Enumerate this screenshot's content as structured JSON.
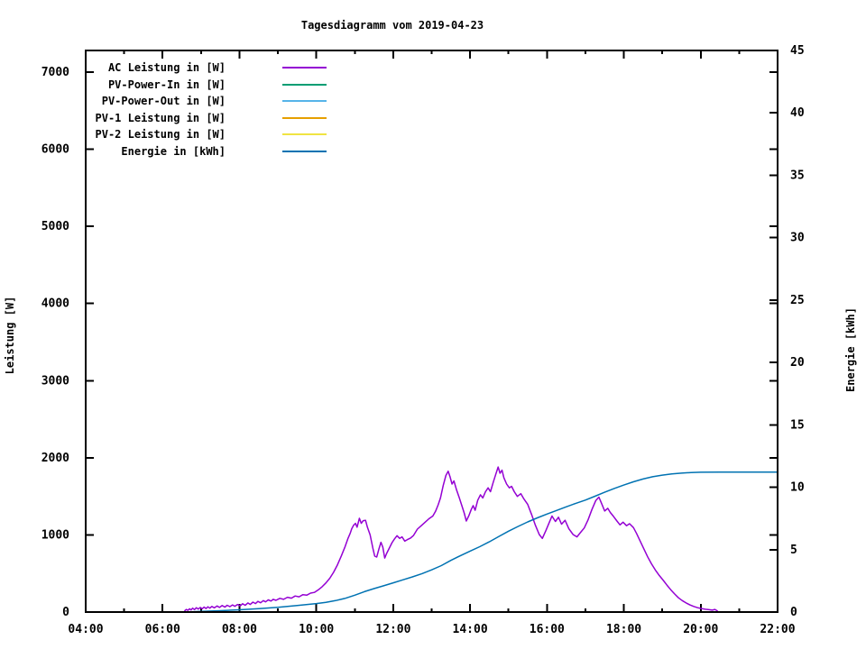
{
  "title": "Tagesdiagramm vom 2019-04-23",
  "colors": {
    "background": "#ffffff",
    "axis": "#000000",
    "ac_leistung": "#9400d3",
    "pv_power_in": "#009e73",
    "pv_power_out": "#56b4e9",
    "pv1_leistung": "#e69f00",
    "pv2_leistung": "#f0e442",
    "energie": "#0072b2"
  },
  "legend": {
    "items": [
      {
        "label": "AC Leistung in [W]",
        "color": "#9400d3"
      },
      {
        "label": "PV-Power-In in [W]",
        "color": "#009e73"
      },
      {
        "label": "PV-Power-Out in [W]",
        "color": "#56b4e9"
      },
      {
        "label": "PV-1 Leistung in [W]",
        "color": "#e69f00"
      },
      {
        "label": "PV-2 Leistung in [W]",
        "color": "#f0e442"
      },
      {
        "label": "Energie in [kWh]",
        "color": "#0072b2"
      }
    ]
  },
  "axes": {
    "x": {
      "range_hours": [
        4,
        22
      ],
      "major_ticks": [
        {
          "hour": 4,
          "label": "04:00"
        },
        {
          "hour": 6,
          "label": "06:00"
        },
        {
          "hour": 8,
          "label": "08:00"
        },
        {
          "hour": 10,
          "label": "10:00"
        },
        {
          "hour": 12,
          "label": "12:00"
        },
        {
          "hour": 14,
          "label": "14:00"
        },
        {
          "hour": 16,
          "label": "16:00"
        },
        {
          "hour": 18,
          "label": "18:00"
        },
        {
          "hour": 20,
          "label": "20:00"
        },
        {
          "hour": 22,
          "label": "22:00"
        }
      ],
      "minor_tick_hours": [
        5,
        7,
        9,
        11,
        13,
        15,
        17,
        19,
        21
      ]
    },
    "y_left": {
      "label": "Leistung [W]",
      "range": [
        0,
        7281
      ],
      "ticks": [
        {
          "value": 0,
          "label": "0"
        },
        {
          "value": 1000,
          "label": "1000"
        },
        {
          "value": 2000,
          "label": "2000"
        },
        {
          "value": 3000,
          "label": "3000"
        },
        {
          "value": 4000,
          "label": "4000"
        },
        {
          "value": 5000,
          "label": "5000"
        },
        {
          "value": 6000,
          "label": "6000"
        },
        {
          "value": 7000,
          "label": "7000"
        }
      ]
    },
    "y_right": {
      "label": "Energie [kWh]",
      "range": [
        0,
        45
      ],
      "ticks": [
        {
          "value": 0,
          "label": "0"
        },
        {
          "value": 5,
          "label": "5"
        },
        {
          "value": 10,
          "label": "10"
        },
        {
          "value": 15,
          "label": "15"
        },
        {
          "value": 20,
          "label": "20"
        },
        {
          "value": 25,
          "label": "25"
        },
        {
          "value": 30,
          "label": "30"
        },
        {
          "value": 35,
          "label": "35"
        },
        {
          "value": 40,
          "label": "40"
        },
        {
          "value": 45,
          "label": "45"
        }
      ]
    }
  },
  "chart_data": {
    "type": "line",
    "title": "Tagesdiagramm vom 2019-04-23",
    "x_unit": "hour_of_day",
    "xlim": [
      4,
      22
    ],
    "ylim_left": [
      0,
      7281
    ],
    "ylim_right": [
      0,
      45
    ],
    "grid": false,
    "legend_position": "top-left-inside",
    "series": [
      {
        "name": "AC Leistung in [W]",
        "color": "#9400d3",
        "axis": "left",
        "points": [
          [
            6.58,
            18
          ],
          [
            6.62,
            34
          ],
          [
            6.66,
            22
          ],
          [
            6.7,
            42
          ],
          [
            6.74,
            27
          ],
          [
            6.78,
            50
          ],
          [
            6.83,
            32
          ],
          [
            6.88,
            56
          ],
          [
            6.93,
            38
          ],
          [
            6.98,
            60
          ],
          [
            7.03,
            42
          ],
          [
            7.08,
            64
          ],
          [
            7.13,
            46
          ],
          [
            7.18,
            68
          ],
          [
            7.23,
            50
          ],
          [
            7.28,
            72
          ],
          [
            7.35,
            55
          ],
          [
            7.42,
            78
          ],
          [
            7.48,
            60
          ],
          [
            7.55,
            84
          ],
          [
            7.62,
            64
          ],
          [
            7.68,
            88
          ],
          [
            7.75,
            70
          ],
          [
            7.82,
            92
          ],
          [
            7.88,
            75
          ],
          [
            7.95,
            98
          ],
          [
            8.02,
            80
          ],
          [
            8.08,
            108
          ],
          [
            8.15,
            88
          ],
          [
            8.22,
            118
          ],
          [
            8.28,
            98
          ],
          [
            8.35,
            128
          ],
          [
            8.42,
            110
          ],
          [
            8.48,
            138
          ],
          [
            8.55,
            120
          ],
          [
            8.62,
            148
          ],
          [
            8.68,
            132
          ],
          [
            8.75,
            158
          ],
          [
            8.82,
            142
          ],
          [
            8.88,
            165
          ],
          [
            8.95,
            152
          ],
          [
            9.05,
            178
          ],
          [
            9.15,
            165
          ],
          [
            9.25,
            192
          ],
          [
            9.35,
            180
          ],
          [
            9.45,
            208
          ],
          [
            9.55,
            198
          ],
          [
            9.65,
            225
          ],
          [
            9.75,
            218
          ],
          [
            9.85,
            245
          ],
          [
            9.95,
            255
          ],
          [
            10.05,
            288
          ],
          [
            10.15,
            328
          ],
          [
            10.25,
            378
          ],
          [
            10.35,
            438
          ],
          [
            10.45,
            515
          ],
          [
            10.55,
            612
          ],
          [
            10.65,
            728
          ],
          [
            10.75,
            850
          ],
          [
            10.82,
            950
          ],
          [
            10.88,
            1020
          ],
          [
            10.92,
            1080
          ],
          [
            10.97,
            1125
          ],
          [
            11.02,
            1150
          ],
          [
            11.06,
            1100
          ],
          [
            11.12,
            1215
          ],
          [
            11.17,
            1150
          ],
          [
            11.22,
            1185
          ],
          [
            11.28,
            1190
          ],
          [
            11.33,
            1100
          ],
          [
            11.4,
            1000
          ],
          [
            11.47,
            830
          ],
          [
            11.52,
            725
          ],
          [
            11.57,
            713
          ],
          [
            11.63,
            820
          ],
          [
            11.68,
            905
          ],
          [
            11.73,
            840
          ],
          [
            11.78,
            700
          ],
          [
            11.83,
            760
          ],
          [
            11.9,
            830
          ],
          [
            11.97,
            900
          ],
          [
            12.03,
            945
          ],
          [
            12.1,
            990
          ],
          [
            12.17,
            955
          ],
          [
            12.23,
            975
          ],
          [
            12.3,
            920
          ],
          [
            12.37,
            940
          ],
          [
            12.45,
            960
          ],
          [
            12.53,
            995
          ],
          [
            12.63,
            1075
          ],
          [
            12.73,
            1120
          ],
          [
            12.83,
            1165
          ],
          [
            12.93,
            1210
          ],
          [
            13.03,
            1245
          ],
          [
            13.1,
            1305
          ],
          [
            13.17,
            1390
          ],
          [
            13.23,
            1480
          ],
          [
            13.3,
            1640
          ],
          [
            13.37,
            1770
          ],
          [
            13.43,
            1825
          ],
          [
            13.48,
            1750
          ],
          [
            13.53,
            1660
          ],
          [
            13.58,
            1700
          ],
          [
            13.65,
            1580
          ],
          [
            13.72,
            1480
          ],
          [
            13.78,
            1390
          ],
          [
            13.85,
            1280
          ],
          [
            13.9,
            1180
          ],
          [
            13.97,
            1250
          ],
          [
            14.03,
            1330
          ],
          [
            14.08,
            1380
          ],
          [
            14.13,
            1320
          ],
          [
            14.2,
            1450
          ],
          [
            14.27,
            1520
          ],
          [
            14.33,
            1480
          ],
          [
            14.4,
            1560
          ],
          [
            14.47,
            1610
          ],
          [
            14.53,
            1560
          ],
          [
            14.6,
            1680
          ],
          [
            14.67,
            1790
          ],
          [
            14.73,
            1880
          ],
          [
            14.78,
            1800
          ],
          [
            14.83,
            1840
          ],
          [
            14.88,
            1740
          ],
          [
            14.95,
            1660
          ],
          [
            15.02,
            1610
          ],
          [
            15.08,
            1630
          ],
          [
            15.15,
            1560
          ],
          [
            15.23,
            1500
          ],
          [
            15.32,
            1535
          ],
          [
            15.4,
            1465
          ],
          [
            15.5,
            1395
          ],
          [
            15.6,
            1265
          ],
          [
            15.7,
            1125
          ],
          [
            15.8,
            1005
          ],
          [
            15.88,
            955
          ],
          [
            15.97,
            1055
          ],
          [
            16.05,
            1150
          ],
          [
            16.13,
            1245
          ],
          [
            16.22,
            1175
          ],
          [
            16.3,
            1230
          ],
          [
            16.38,
            1140
          ],
          [
            16.47,
            1190
          ],
          [
            16.57,
            1080
          ],
          [
            16.68,
            1005
          ],
          [
            16.78,
            975
          ],
          [
            16.88,
            1035
          ],
          [
            16.97,
            1090
          ],
          [
            17.07,
            1195
          ],
          [
            17.17,
            1330
          ],
          [
            17.27,
            1445
          ],
          [
            17.35,
            1490
          ],
          [
            17.43,
            1395
          ],
          [
            17.5,
            1310
          ],
          [
            17.58,
            1345
          ],
          [
            17.65,
            1290
          ],
          [
            17.73,
            1240
          ],
          [
            17.82,
            1180
          ],
          [
            17.9,
            1130
          ],
          [
            17.98,
            1165
          ],
          [
            18.07,
            1120
          ],
          [
            18.15,
            1145
          ],
          [
            18.25,
            1095
          ],
          [
            18.33,
            1020
          ],
          [
            18.42,
            925
          ],
          [
            18.52,
            820
          ],
          [
            18.62,
            715
          ],
          [
            18.72,
            625
          ],
          [
            18.82,
            545
          ],
          [
            18.92,
            475
          ],
          [
            19.02,
            415
          ],
          [
            19.12,
            350
          ],
          [
            19.22,
            290
          ],
          [
            19.32,
            235
          ],
          [
            19.42,
            185
          ],
          [
            19.52,
            148
          ],
          [
            19.62,
            118
          ],
          [
            19.72,
            92
          ],
          [
            19.82,
            72
          ],
          [
            19.92,
            56
          ],
          [
            20.02,
            45
          ],
          [
            20.12,
            36
          ],
          [
            20.22,
            30
          ],
          [
            20.3,
            24
          ],
          [
            20.37,
            34
          ],
          [
            20.43,
            16
          ]
        ]
      },
      {
        "name": "PV-Power-In in [W]",
        "color": "#009e73",
        "axis": "left",
        "points": []
      },
      {
        "name": "PV-Power-Out in [W]",
        "color": "#56b4e9",
        "axis": "left",
        "points": []
      },
      {
        "name": "PV-1 Leistung in [W]",
        "color": "#e69f00",
        "axis": "left",
        "points": []
      },
      {
        "name": "PV-2 Leistung in [W]",
        "color": "#f0e442",
        "axis": "left",
        "points": []
      },
      {
        "name": "Energie in [kWh]",
        "color": "#0072b2",
        "axis": "right",
        "points": [
          [
            6.6,
            0
          ],
          [
            7.0,
            0.05
          ],
          [
            7.5,
            0.11
          ],
          [
            8.0,
            0.18
          ],
          [
            8.5,
            0.27
          ],
          [
            9.0,
            0.38
          ],
          [
            9.5,
            0.52
          ],
          [
            10.0,
            0.68
          ],
          [
            10.25,
            0.78
          ],
          [
            10.5,
            0.92
          ],
          [
            10.75,
            1.1
          ],
          [
            11.0,
            1.35
          ],
          [
            11.25,
            1.63
          ],
          [
            11.5,
            1.88
          ],
          [
            11.75,
            2.1
          ],
          [
            12.0,
            2.34
          ],
          [
            12.25,
            2.58
          ],
          [
            12.5,
            2.82
          ],
          [
            12.75,
            3.08
          ],
          [
            13.0,
            3.38
          ],
          [
            13.25,
            3.72
          ],
          [
            13.5,
            4.14
          ],
          [
            13.75,
            4.52
          ],
          [
            14.0,
            4.88
          ],
          [
            14.25,
            5.24
          ],
          [
            14.5,
            5.63
          ],
          [
            14.75,
            6.06
          ],
          [
            15.0,
            6.48
          ],
          [
            15.25,
            6.86
          ],
          [
            15.5,
            7.22
          ],
          [
            15.75,
            7.55
          ],
          [
            16.0,
            7.85
          ],
          [
            16.25,
            8.14
          ],
          [
            16.5,
            8.43
          ],
          [
            16.75,
            8.71
          ],
          [
            17.0,
            8.97
          ],
          [
            17.25,
            9.28
          ],
          [
            17.5,
            9.6
          ],
          [
            17.75,
            9.9
          ],
          [
            18.0,
            10.18
          ],
          [
            18.25,
            10.44
          ],
          [
            18.5,
            10.66
          ],
          [
            18.75,
            10.84
          ],
          [
            19.0,
            10.97
          ],
          [
            19.25,
            11.07
          ],
          [
            19.5,
            11.13
          ],
          [
            19.75,
            11.18
          ],
          [
            20.0,
            11.2
          ],
          [
            20.5,
            11.22
          ],
          [
            21.0,
            11.22
          ],
          [
            21.5,
            11.22
          ],
          [
            22.0,
            11.22
          ]
        ]
      }
    ]
  }
}
